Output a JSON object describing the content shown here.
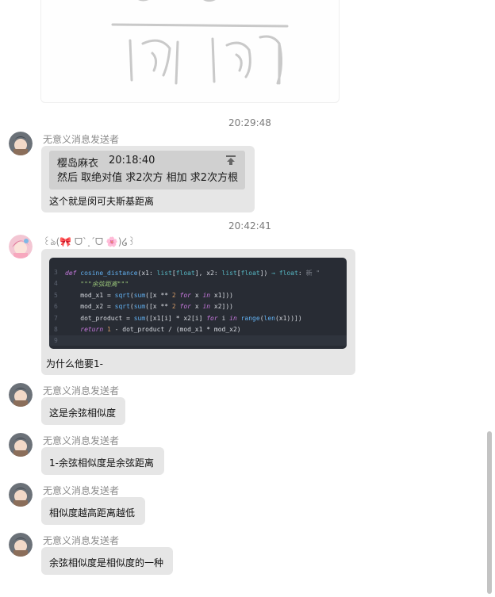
{
  "messages": [
    {
      "timestamp": "20:29:48",
      "sender": "无意义消息发送者",
      "quote": {
        "author": "樱岛麻衣",
        "time": "20:18:40",
        "text": "然后 取绝对值 求2次方 相加 求2次方根"
      },
      "text": "这个就是闵可夫斯基距离"
    },
    {
      "timestamp": "20:42:41",
      "sender": "꒰ঌ(🎀 ᗜ`˰´ᗜ 🌸)໒꒱",
      "code_lines": [
        {
          "no": "3",
          "text": "def cosine_distance(x1: list[float], x2: list[float]) → float: 新"
        },
        {
          "no": "4",
          "text": "\"\"\"余弦距离\"\"\""
        },
        {
          "no": "5",
          "text": "mod_x1 = sqrt(sum([x ** 2 for x in x1]))"
        },
        {
          "no": "6",
          "text": "mod_x2 = sqrt(sum([x ** 2 for x in x2]))"
        },
        {
          "no": "7",
          "text": "dot_product = sum([x1[i] * x2[i] for i in range(len(x1))])"
        },
        {
          "no": "8",
          "text": "return 1 - dot_product / (mod_x1 * mod_x2)"
        },
        {
          "no": "9",
          "text": ""
        }
      ],
      "text": "为什么他要1-"
    },
    {
      "sender": "无意义消息发送者",
      "text": "这是余弦相似度"
    },
    {
      "sender": "无意义消息发送者",
      "text": "1-余弦相似度是余弦距离"
    },
    {
      "sender": "无意义消息发送者",
      "text": "相似度越高距离越低"
    },
    {
      "sender": "无意义消息发送者",
      "text": "余弦相似度是相似度的一种"
    }
  ]
}
